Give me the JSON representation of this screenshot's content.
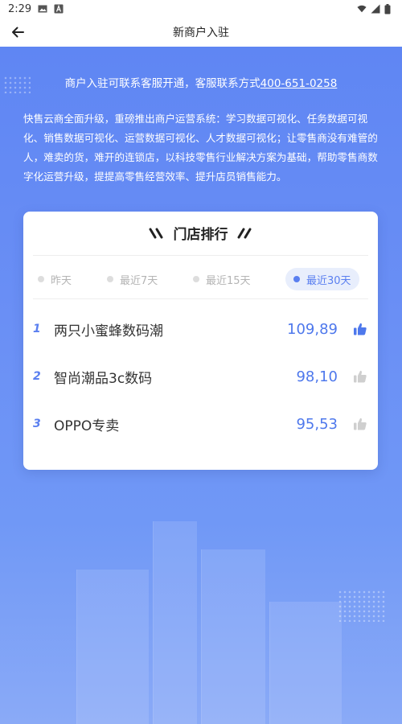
{
  "status_bar": {
    "time": "2:29",
    "icons": [
      "image-icon",
      "font-icon",
      "wifi-icon",
      "signal-icon",
      "battery-icon"
    ]
  },
  "header": {
    "title": "新商户入驻",
    "back_icon": "back-arrow-icon"
  },
  "contact": {
    "text": "商户入驻可联系客服开通，客服联系方式",
    "phone": "400-651-0258"
  },
  "intro": "快售云商全面升级，重磅推出商户运营系统：学习数据可视化、任务数据可视化、销售数据可视化、运营数据可视化、人才数据可视化；让零售商没有难管的人，难卖的货，难开的连锁店，以科技零售行业解决方案为基础，帮助零售商数字化运营升级，提提高零售经营效率、提升店员销售能力。",
  "ranking": {
    "title": "门店排行",
    "tabs": [
      {
        "label": "昨天",
        "active": false
      },
      {
        "label": "最近7天",
        "active": false
      },
      {
        "label": "最近15天",
        "active": false
      },
      {
        "label": "最近30天",
        "active": true
      }
    ],
    "rows": [
      {
        "rank": "1",
        "name": "两只小蜜蜂数码潮",
        "value": "109,89",
        "liked": true
      },
      {
        "rank": "2",
        "name": "智尚潮品3c数码",
        "value": "98,10",
        "liked": false
      },
      {
        "rank": "3",
        "name": "OPPO专卖",
        "value": "95,53",
        "liked": false
      }
    ]
  },
  "colors": {
    "accent": "#5a7ff0",
    "hero": "#6a8ff5",
    "thumb_active": "#4e78ec",
    "thumb_inactive": "#cfcfcf"
  }
}
